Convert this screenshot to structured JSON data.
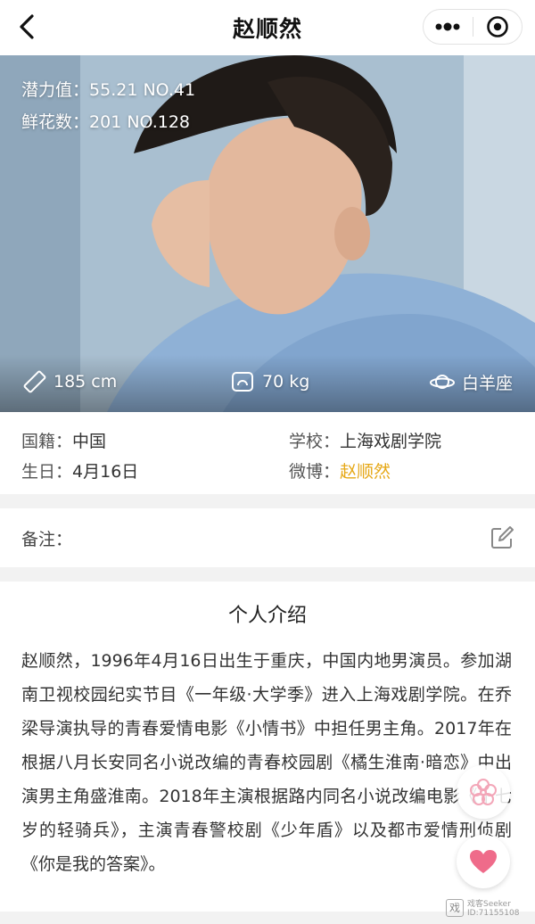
{
  "nav": {
    "title": "赵顺然"
  },
  "hero": {
    "potential_label": "潜力值：",
    "potential_value": "55.21 NO.41",
    "flowers_label": "鲜花数：",
    "flowers_value": "201 NO.128",
    "height": "185 cm",
    "weight": "70 kg",
    "zodiac": "白羊座"
  },
  "info": {
    "nationality_label": "国籍：",
    "nationality_value": "中国",
    "school_label": "学校：",
    "school_value": "上海戏剧学院",
    "birthday_label": "生日：",
    "birthday_value": "4月16日",
    "weibo_label": "微博：",
    "weibo_value": "赵顺然"
  },
  "note": {
    "label": "备注："
  },
  "intro": {
    "title": "个人介绍",
    "text": "赵顺然，1996年4月16日出生于重庆，中国内地男演员。参加湖南卫视校园纪实节目《一年级·大学季》进入上海戏剧学院。在乔梁导演执导的青春爱情电影《小情书》中担任男主角。2017年在根据八月长安同名小说改编的青春校园剧《橘生淮南·暗恋》中出演男主角盛淮南。2018年主演根据路内同名小说改编电影《十七岁的轻骑兵》，主演青春警校剧《少年盾》以及都市爱情刑侦剧《你是我的答案》。"
  },
  "watermark": {
    "line1": "戏客Seeker",
    "line2": "ID:71155108"
  },
  "colors": {
    "accent": "#e6a817",
    "heart": "#ef6b8a"
  }
}
